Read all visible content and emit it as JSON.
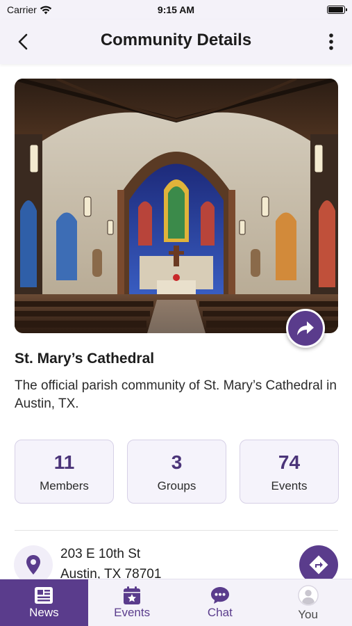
{
  "status_bar": {
    "carrier": "Carrier",
    "time": "9:15 AM"
  },
  "header": {
    "title": "Community Details",
    "back_icon": "chevron-left-icon",
    "menu_icon": "more-vertical-icon"
  },
  "hero": {
    "description": "cathedral interior photo",
    "share_icon": "share-arrow-icon"
  },
  "community": {
    "name": "St. Mary’s Cathedral",
    "description": "The official parish community of St. Mary’s Cathedral in Austin, TX."
  },
  "stats": [
    {
      "value": "11",
      "label": "Members"
    },
    {
      "value": "3",
      "label": "Groups"
    },
    {
      "value": "74",
      "label": "Events"
    }
  ],
  "address": {
    "line1": "203 E 10th St",
    "line2": "Austin, TX 78701",
    "icon": "location-pin-icon",
    "directions_icon": "directions-icon"
  },
  "tabs": [
    {
      "label": "News",
      "icon": "newspaper-icon",
      "active": true
    },
    {
      "label": "Events",
      "icon": "calendar-star-icon",
      "active": false
    },
    {
      "label": "Chat",
      "icon": "chat-bubble-icon",
      "active": false
    },
    {
      "label": "You",
      "icon": "user-avatar-icon",
      "active": false
    }
  ],
  "colors": {
    "accent": "#5a3c8c",
    "stat_text": "#4b3479",
    "header_bg": "#f4f2f9"
  }
}
